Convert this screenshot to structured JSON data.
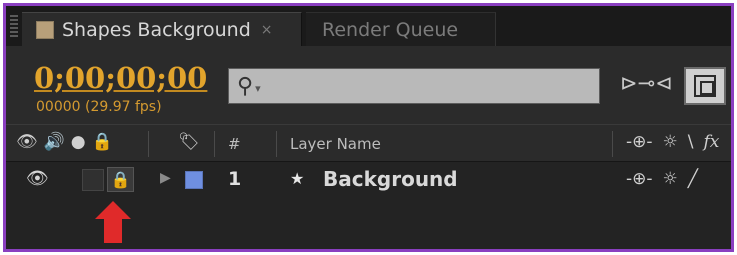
{
  "tabs": [
    {
      "title": "Shapes Background",
      "close": "×",
      "active": true
    },
    {
      "title": "Render Queue",
      "active": false
    }
  ],
  "time": {
    "timecode": "0;00;00;00",
    "fps_label": "00000 (29.97 fps)"
  },
  "search": {
    "icon": "⚲",
    "caret": "▾",
    "value": "",
    "placeholder": ""
  },
  "header": {
    "icons": {
      "eye": "👁",
      "audio": "🔊",
      "solo": "●",
      "lock": "🔒",
      "label": "🏷"
    },
    "hash": "#",
    "layer_name": "Layer Name",
    "switches": {
      "shy": "-⊕-",
      "quality": "☼",
      "fx": "fx",
      "motion": "\\"
    }
  },
  "layer": {
    "eye": "👁",
    "lock": "🔒",
    "twirl": "▶",
    "label_color": "#6f8fe0",
    "number": "1",
    "star": "★",
    "name": "Background",
    "switches": {
      "shy": "-⊕-",
      "quality": "☼",
      "slash": "╱"
    }
  },
  "annotation": {
    "arrow_color": "#e02a2a",
    "points_to": "lock-toggle"
  }
}
